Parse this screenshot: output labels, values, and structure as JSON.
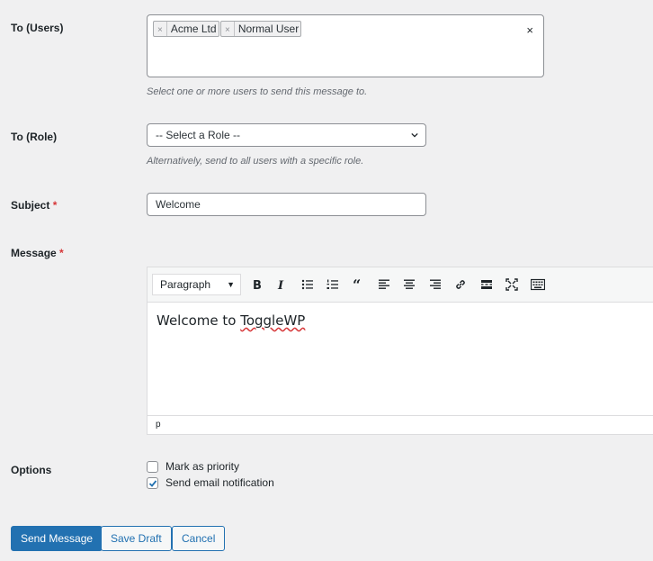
{
  "form": {
    "to_users": {
      "label": "To (Users)",
      "selected": [
        "Acme Ltd",
        "Normal User"
      ],
      "remove_glyph": "×",
      "clear_glyph": "×",
      "help": "Select one or more users to send this message to."
    },
    "to_role": {
      "label": "To (Role)",
      "value": "-- Select a Role --",
      "help": "Alternatively, send to all users with a specific role."
    },
    "subject": {
      "label": "Subject",
      "required_mark": "*",
      "value": "Welcome"
    },
    "message": {
      "label": "Message",
      "required_mark": "*",
      "format": "Paragraph",
      "body_prefix": "Welcome to ",
      "body_misspelled": "ToggleWP",
      "path": "p",
      "toolbar_icons": [
        "bold-icon",
        "italic-icon",
        "bullet-list-icon",
        "numbered-list-icon",
        "blockquote-icon",
        "align-left-icon",
        "align-center-icon",
        "align-right-icon",
        "link-icon",
        "read-more-icon",
        "fullscreen-icon",
        "toolbar-toggle-icon"
      ]
    },
    "options": {
      "label": "Options",
      "items": [
        {
          "label": "Mark as priority",
          "checked": false
        },
        {
          "label": "Send email notification",
          "checked": true
        }
      ]
    }
  },
  "actions": {
    "send": "Send Message",
    "draft": "Save Draft",
    "cancel": "Cancel"
  },
  "colors": {
    "primary": "#2271b1",
    "required": "#d63638",
    "background": "#f0f0f1"
  }
}
